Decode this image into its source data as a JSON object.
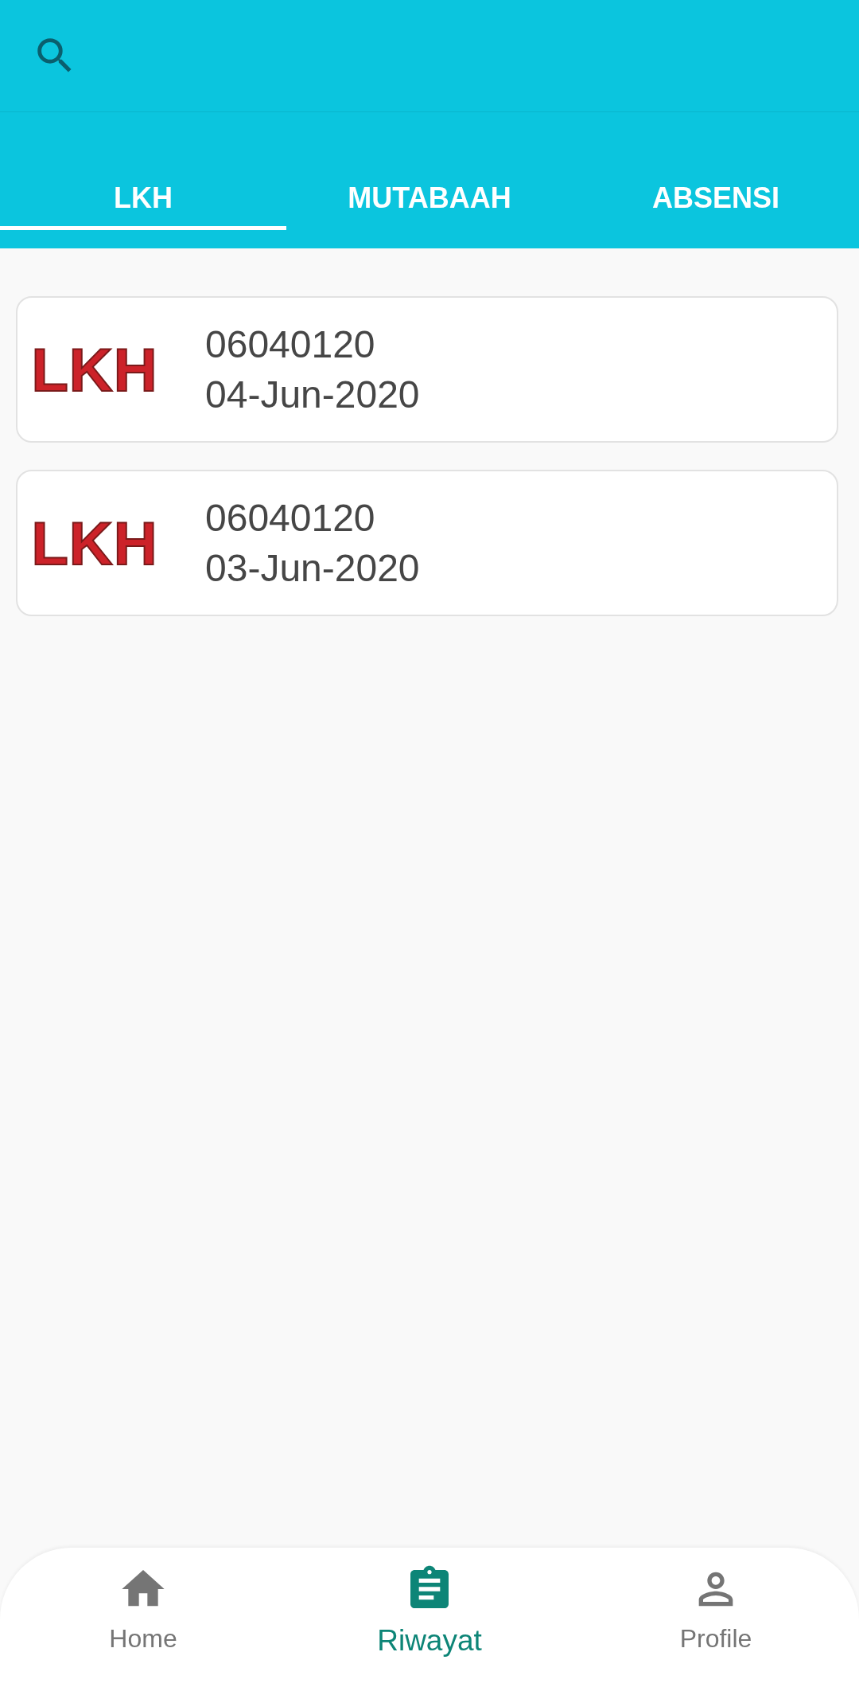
{
  "tabs": [
    {
      "label": "LKH",
      "selected": true
    },
    {
      "label": "MUTABAAH",
      "selected": false
    },
    {
      "label": "ABSENSI",
      "selected": false
    }
  ],
  "records": [
    {
      "logo": "LKH",
      "number": "06040120",
      "date": "04-Jun-2020"
    },
    {
      "logo": "LKH",
      "number": "06040120",
      "date": "03-Jun-2020"
    }
  ],
  "bottom_nav": [
    {
      "kind": "home",
      "label": "Home",
      "selected": false
    },
    {
      "kind": "history",
      "label": "Riwayat",
      "selected": true
    },
    {
      "kind": "profile",
      "label": "Profile",
      "selected": false
    }
  ]
}
